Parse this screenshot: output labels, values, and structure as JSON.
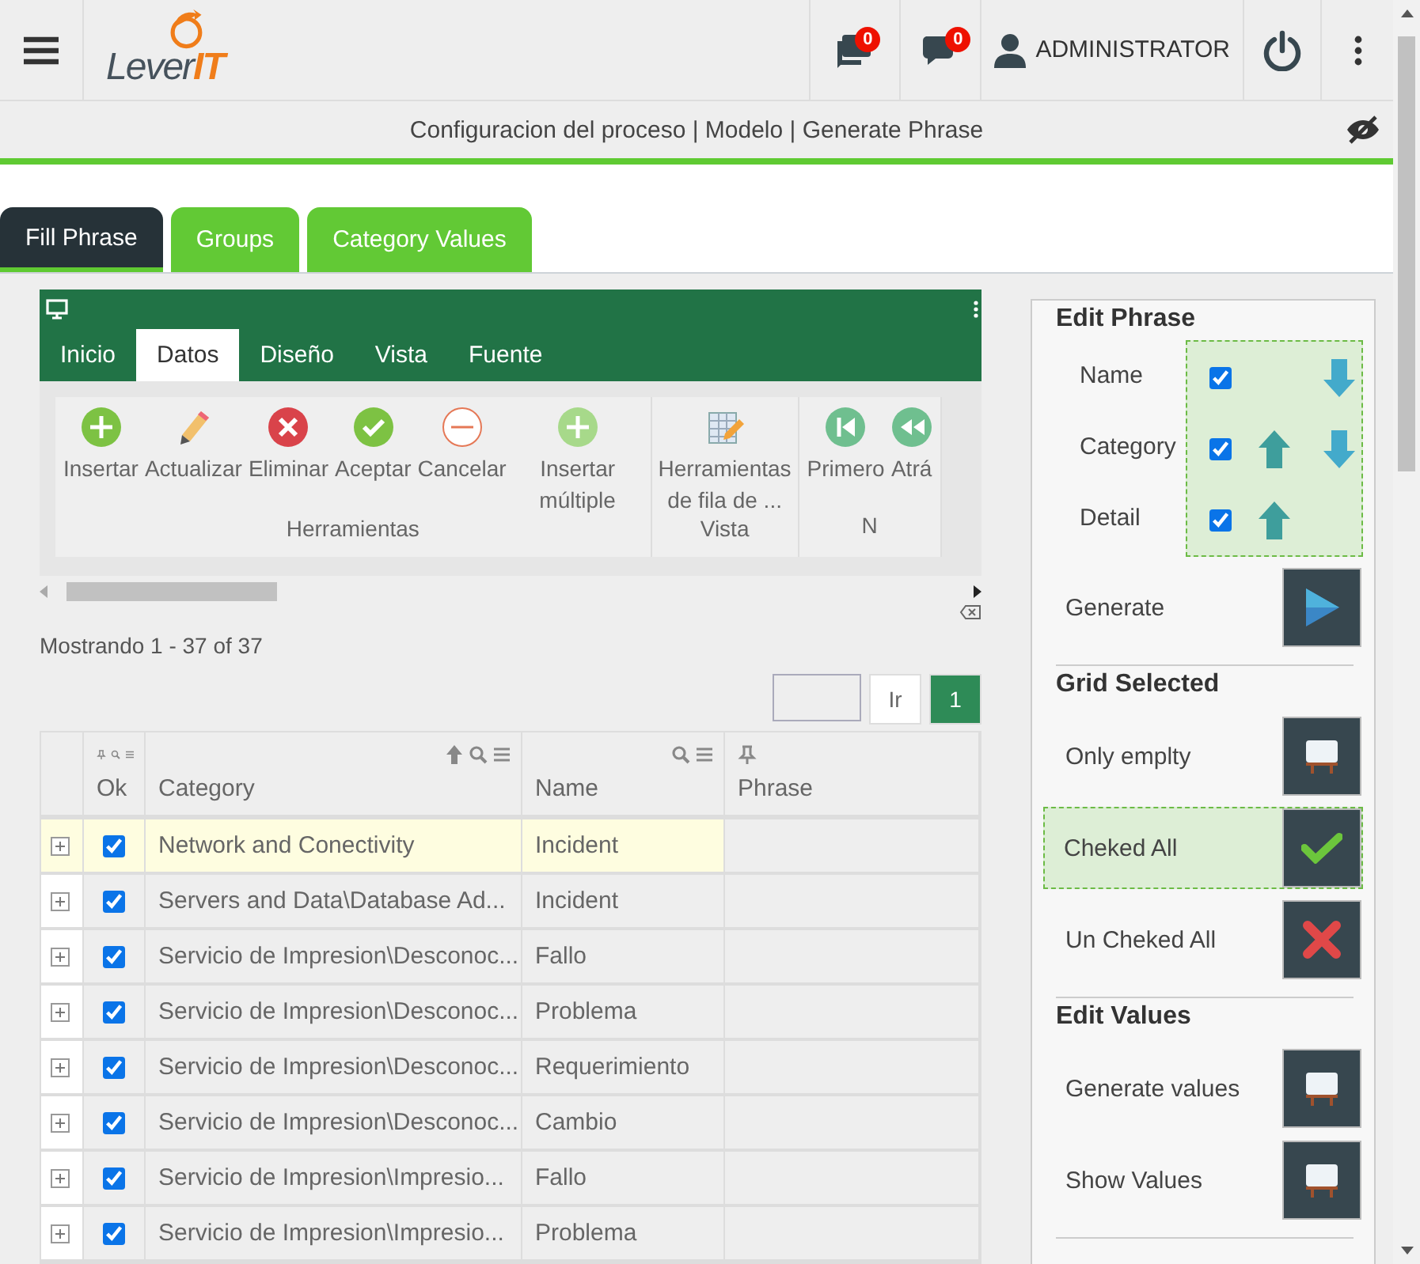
{
  "header": {
    "logo": {
      "text": "Lever",
      "accent": "IT"
    },
    "notifications": [
      {
        "kind": "chat",
        "count": "0"
      },
      {
        "kind": "chats",
        "count": "0"
      }
    ],
    "user": "ADMINISTRATOR"
  },
  "breadcrumb": "Configuracion del proceso | Modelo | Generate Phrase",
  "tabs": [
    {
      "label": "Fill Phrase",
      "selected": true
    },
    {
      "label": "Groups",
      "selected": false
    },
    {
      "label": "Category Values",
      "selected": false
    }
  ],
  "ribbon": {
    "tabs": [
      {
        "label": "Inicio",
        "selected": false
      },
      {
        "label": "Datos",
        "selected": true
      },
      {
        "label": "Diseño",
        "selected": false
      },
      {
        "label": "Vista",
        "selected": false
      },
      {
        "label": "Fuente",
        "selected": false
      }
    ],
    "groups": [
      {
        "label": "Herramientas",
        "items": [
          {
            "label": "Insertar",
            "kind": "add"
          },
          {
            "label": "Actualizar",
            "kind": "edit"
          },
          {
            "label": "Eliminar",
            "kind": "delete"
          },
          {
            "label": "Aceptar",
            "kind": "accept"
          },
          {
            "label": "Cancelar",
            "kind": "cancel"
          },
          {
            "label": "Insertar múltiple",
            "kind": "multiple"
          }
        ]
      },
      {
        "label": "Vista",
        "items": [
          {
            "label": "Herramientas de fila de ...",
            "kind": "table"
          }
        ]
      },
      {
        "label": "N",
        "items": [
          {
            "label": "Primero",
            "kind": "first"
          },
          {
            "label": "Atrá",
            "kind": "back"
          }
        ]
      }
    ]
  },
  "status": "Mostrando 1 - 37 of 37",
  "pager": {
    "go": "Ir",
    "pages": [
      {
        "label": "1",
        "selected": true
      }
    ]
  },
  "table": {
    "columns": [
      {
        "label": "Ok"
      },
      {
        "label": "Category"
      },
      {
        "label": "Name"
      },
      {
        "label": "Phrase"
      }
    ],
    "rows": [
      {
        "checked": true,
        "selected": true,
        "category": "Network and Conectivity",
        "name": "Incident"
      },
      {
        "checked": true,
        "selected": false,
        "category": "Servers and Data\\Database Ad...",
        "name": "Incident"
      },
      {
        "checked": true,
        "selected": false,
        "category": "Servicio de Impresion\\Desconoc...",
        "name": "Fallo"
      },
      {
        "checked": true,
        "selected": false,
        "category": "Servicio de Impresion\\Desconoc...",
        "name": "Problema"
      },
      {
        "checked": true,
        "selected": false,
        "category": "Servicio de Impresion\\Desconoc...",
        "name": "Requerimiento"
      },
      {
        "checked": true,
        "selected": false,
        "category": "Servicio de Impresion\\Desconoc...",
        "name": "Cambio"
      },
      {
        "checked": true,
        "selected": false,
        "category": "Servicio de Impresion\\Impresio...",
        "name": "Fallo"
      },
      {
        "checked": true,
        "selected": false,
        "category": "Servicio de Impresion\\Impresio...",
        "name": "Problema"
      }
    ]
  },
  "panel": {
    "sections": [
      {
        "title": "Edit Phrase",
        "items": [
          {
            "kind": "order",
            "label": "Name",
            "checked": true,
            "up": false,
            "down": true
          },
          {
            "kind": "order",
            "label": "Category",
            "checked": true,
            "up": true,
            "down": true
          },
          {
            "kind": "order",
            "label": "Detail",
            "checked": true,
            "up": true,
            "down": false
          },
          {
            "kind": "play",
            "label": "Generate",
            "selected": false
          }
        ]
      },
      {
        "title": "Grid Selected",
        "items": [
          {
            "kind": "board",
            "label": "Only emplty",
            "selected": false
          },
          {
            "kind": "check",
            "label": "Cheked All",
            "selected": true
          },
          {
            "kind": "cross",
            "label": "Un Cheked All",
            "selected": false
          }
        ]
      },
      {
        "title": "Edit Values",
        "items": [
          {
            "kind": "board",
            "label": "Generate values",
            "selected": false
          },
          {
            "kind": "board",
            "label": "Show Values",
            "selected": false
          }
        ]
      }
    ]
  }
}
